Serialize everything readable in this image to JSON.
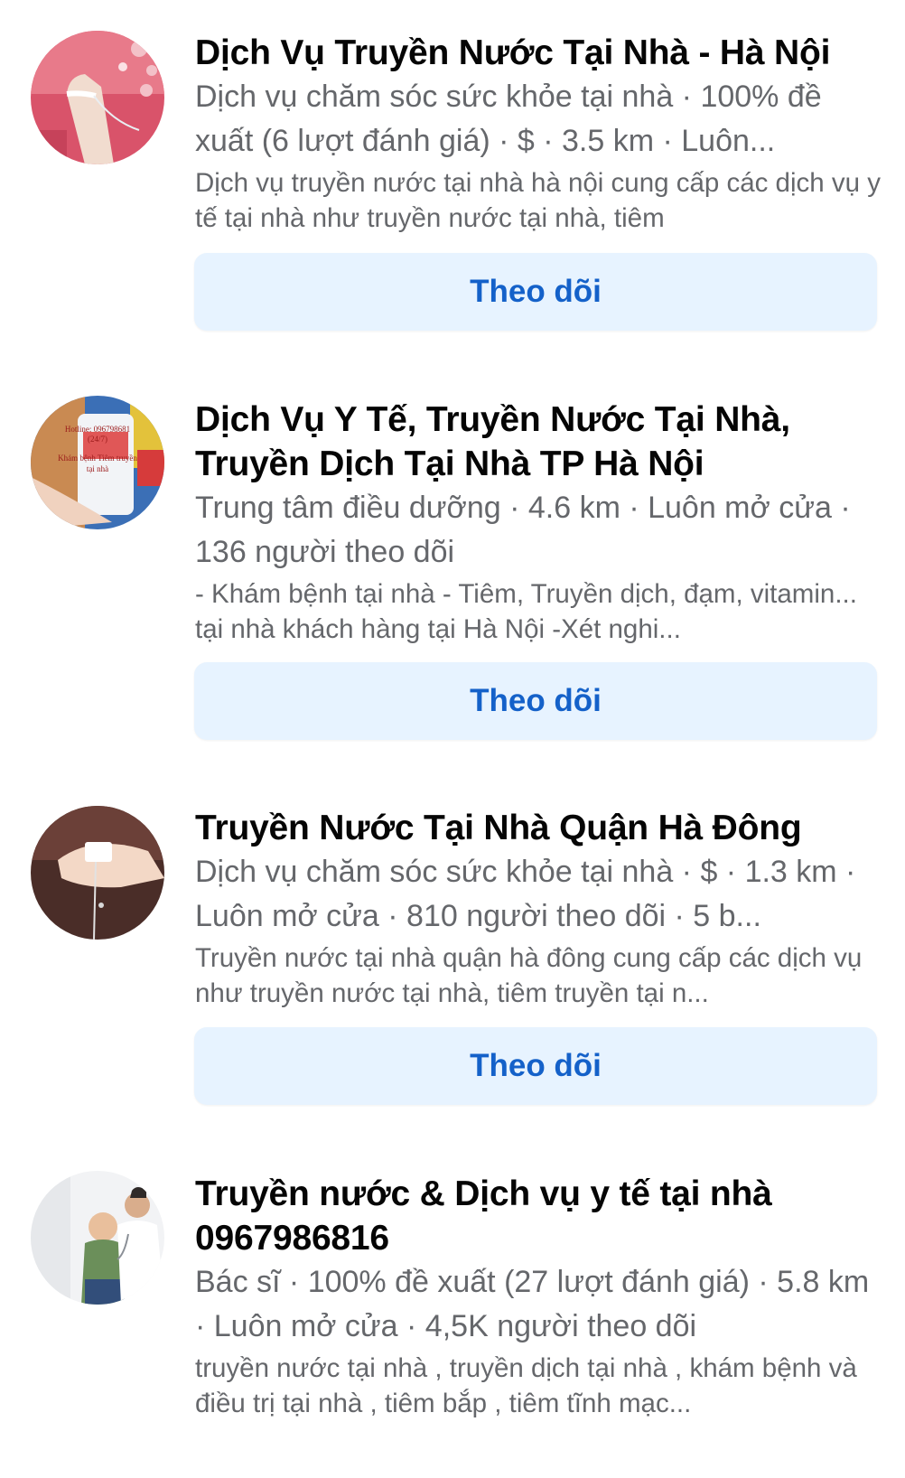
{
  "results": [
    {
      "title": "Dịch Vụ Truyền Nước Tại Nhà - Hà Nội",
      "meta": "Dịch vụ chăm sóc sức khỏe tại nhà · 100% đề xuất (6 lượt đánh giá) · $ · 3.5 km · Luôn...",
      "description": "Dịch vụ truyền nước tại nhà hà nội cung cấp các dịch vụ y tế tại nhà như truyền nước tại nhà, tiêm",
      "follow_label": "Theo dõi",
      "avatar_icon": "iv-drip-arm-photo"
    },
    {
      "title": "Dịch Vụ Y Tế, Truyền Nước Tại Nhà, Truyền Dịch Tại Nhà TP Hà Nội",
      "meta": "Trung tâm điều dưỡng · 4.6 km · Luôn mở cửa · 136 người theo dõi",
      "description": "- Khám bệnh tại nhà - Tiêm, Truyền dịch, đạm, vitamin... tại nhà khách hàng tại Hà Nội -Xét nghi...",
      "follow_label": "Theo dõi",
      "avatar_icon": "iv-bag-photo",
      "avatar_text": [
        "Hotline: 096798681",
        "(24/7)",
        "Khám bệnh Tiêm truyền",
        "tại nhà"
      ]
    },
    {
      "title": "Truyền Nước Tại Nhà Quận Hà Đông",
      "meta": "Dịch vụ chăm sóc sức khỏe tại nhà · $ · 1.3 km · Luôn mở cửa · 810 người theo dõi · 5 b...",
      "description": "Truyền nước tại nhà quận hà đông cung cấp các dịch vụ như truyền nước tại nhà, tiêm truyền tại n...",
      "follow_label": "Theo dõi",
      "avatar_icon": "iv-line-hand-photo"
    },
    {
      "title": "Truyền nước & Dịch vụ y tế tại nhà 0967986816",
      "meta": "Bác sĩ · 100% đề xuất (27 lượt đánh giá) · 5.8 km · Luôn mở cửa · 4,5K người theo dõi",
      "description": "truyền nước tại nhà , truyền dịch tại nhà , khám bệnh và điều trị tại nhà , tiêm bắp , tiêm tĩnh mạc...",
      "avatar_icon": "doctor-child-photo"
    }
  ],
  "colors": {
    "title": "#050505",
    "secondary_text": "#65676b",
    "button_bg": "#e7f3ff",
    "button_text": "#1461c9"
  }
}
